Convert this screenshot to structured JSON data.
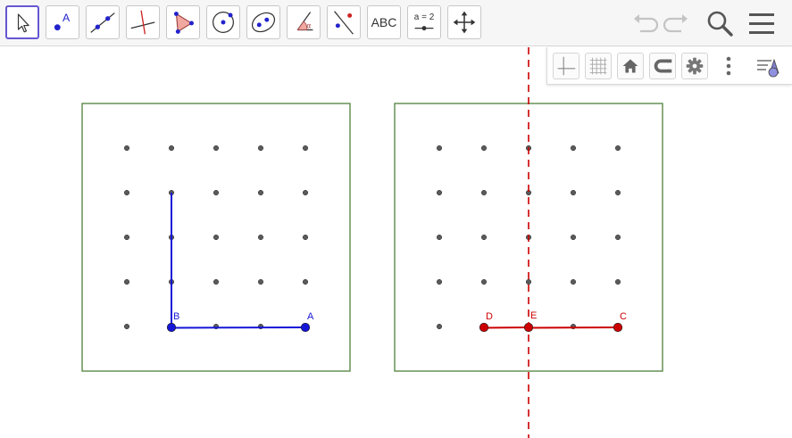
{
  "toolbar": {
    "tools": [
      {
        "name": "move-tool-button",
        "icon": "cursor-arrow-icon",
        "active": true
      },
      {
        "name": "point-tool-button",
        "icon": "point-icon",
        "glyph": "A"
      },
      {
        "name": "line-tool-button",
        "icon": "line-through-points-icon"
      },
      {
        "name": "perpendicular-line-tool-button",
        "icon": "perpendicular-line-icon"
      },
      {
        "name": "polygon-tool-button",
        "icon": "polygon-icon"
      },
      {
        "name": "circle-tool-button",
        "icon": "circle-center-point-icon"
      },
      {
        "name": "ellipse-tool-button",
        "icon": "ellipse-icon"
      },
      {
        "name": "angle-tool-button",
        "icon": "angle-icon",
        "glyph": "α"
      },
      {
        "name": "reflect-tool-button",
        "icon": "reflect-about-line-icon"
      },
      {
        "name": "text-tool-button",
        "icon": "text-icon",
        "label": "ABC"
      },
      {
        "name": "slider-tool-button",
        "icon": "slider-icon",
        "label": "a = 2"
      },
      {
        "name": "move-graphics-view-tool-button",
        "icon": "move-graphics-view-icon"
      }
    ],
    "right": [
      {
        "name": "undo-button",
        "icon": "undo-icon"
      },
      {
        "name": "redo-button",
        "icon": "redo-icon"
      },
      {
        "name": "search-button",
        "icon": "search-icon"
      },
      {
        "name": "menu-button",
        "icon": "hamburger-menu-icon"
      }
    ]
  },
  "style_bar": {
    "buttons": [
      {
        "name": "toggle-axes-button",
        "icon": "axes-icon"
      },
      {
        "name": "toggle-grid-button",
        "icon": "grid-icon"
      },
      {
        "name": "standard-view-button",
        "icon": "home-icon"
      },
      {
        "name": "point-capturing-button",
        "icon": "magnet-icon"
      },
      {
        "name": "graphics-settings-button",
        "icon": "gear-icon"
      },
      {
        "name": "more-options-button",
        "icon": "vertical-dots-icon"
      },
      {
        "name": "toggle-style-bar-button",
        "icon": "style-bar-toggle-icon"
      }
    ]
  },
  "colors": {
    "frame": "#5a8a4a",
    "grid_dot": "#5a5a5a",
    "blue": "#1515d8",
    "red": "#cc0000",
    "active_tool": "#6557d2"
  },
  "geoboards": [
    {
      "name": "left-geoboard",
      "rows": 5,
      "cols": 5,
      "segments": [
        {
          "name": "vertical-segment",
          "color": "blue",
          "from": [
            2,
            2
          ],
          "to": [
            2,
            5
          ]
        },
        {
          "name": "segment-ab",
          "color": "blue",
          "from": [
            2,
            5
          ],
          "to": [
            5,
            5
          ]
        }
      ],
      "points": [
        {
          "label": "B",
          "color": "blue",
          "col": 2,
          "row": 5
        },
        {
          "label": "A",
          "color": "blue",
          "col": 5,
          "row": 5
        }
      ]
    },
    {
      "name": "right-geoboard",
      "rows": 5,
      "cols": 5,
      "segments": [
        {
          "name": "segment-de",
          "color": "red",
          "from": [
            2,
            5
          ],
          "to": [
            3,
            5
          ]
        },
        {
          "name": "segment-ec",
          "color": "red",
          "from": [
            3,
            5
          ],
          "to": [
            5,
            5
          ]
        }
      ],
      "points": [
        {
          "label": "D",
          "color": "red",
          "col": 2,
          "row": 5
        },
        {
          "label": "E",
          "color": "red",
          "col": 3,
          "row": 5
        },
        {
          "label": "C",
          "color": "red",
          "col": 5,
          "row": 5
        }
      ]
    }
  ],
  "mirror_line": {
    "name": "mirror-line",
    "color": "red",
    "style": "dashed",
    "through_col_of_right_board": 3
  }
}
